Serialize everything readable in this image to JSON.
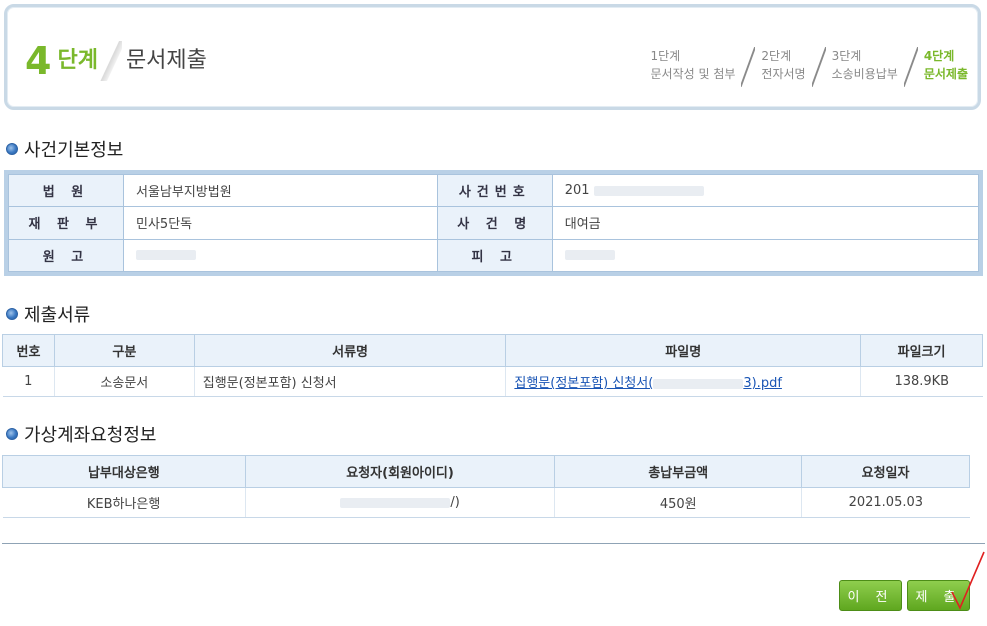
{
  "header": {
    "step_number": "4",
    "step_word": "단계",
    "step_name": "문서제출",
    "steps": [
      {
        "line1": "1단계",
        "line2": "문서작성 및 첨부",
        "active": false
      },
      {
        "line1": "2단계",
        "line2": "전자서명",
        "active": false
      },
      {
        "line1": "3단계",
        "line2": "소송비용납부",
        "active": false
      },
      {
        "line1": "4단계",
        "line2": "문서제출",
        "active": true
      }
    ]
  },
  "case_info": {
    "section_title": "사건기본정보",
    "court_label": "법 원",
    "court_value": "서울남부지방법원",
    "case_no_label": "사건번호",
    "case_no_value": "201",
    "division_label": "재 판 부",
    "division_value": "민사5단독",
    "case_name_label": "사 건 명",
    "case_name_value": "대여금",
    "plaintiff_label": "원 고",
    "defendant_label": "피 고"
  },
  "documents": {
    "section_title": "제출서류",
    "headers": [
      "번호",
      "구분",
      "서류명",
      "파일명",
      "파일크기"
    ],
    "rows": [
      {
        "no": "1",
        "type": "소송문서",
        "doc_name": "집행문(정본포함) 신청서",
        "file_prefix": "집행문(정본포함) 신청서(",
        "file_suffix": "3).pdf",
        "size": "138.9KB"
      }
    ]
  },
  "virtual_account": {
    "section_title": "가상계좌요청정보",
    "headers": [
      "납부대상은행",
      "요청자(회원아이디)",
      "총납부금액",
      "요청일자"
    ],
    "rows": [
      {
        "bank": "KEB하나은행",
        "requester_suffix": "/)",
        "amount": "450원",
        "date": "2021.05.03"
      }
    ]
  },
  "buttons": {
    "prev": "이 전",
    "submit": "제 출"
  },
  "colors": {
    "accent_green": "#7ab82b",
    "button_green": "#5fa71f",
    "link_blue": "#1a55b5",
    "header_blue": "#eaf2fa"
  }
}
